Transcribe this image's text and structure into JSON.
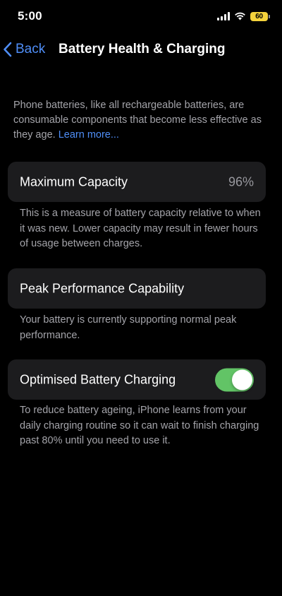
{
  "status_bar": {
    "time": "5:00",
    "battery_percent": "60",
    "battery_color": "#f5d33c",
    "signal_icon": "cellular-signal-icon",
    "wifi_icon": "wifi-icon"
  },
  "nav": {
    "back_label": "Back",
    "back_icon": "chevron-left-icon",
    "title": "Battery Health & Charging",
    "accent_color": "#4f8ef7"
  },
  "intro": {
    "text": "Phone batteries, like all rechargeable batteries, are consumable components that become less effective as they age.",
    "link": "Learn more..."
  },
  "maximum_capacity": {
    "label": "Maximum Capacity",
    "value": "96%",
    "footnote": "This is a measure of battery capacity relative to when it was new. Lower capacity may result in fewer hours of usage between charges."
  },
  "peak_performance": {
    "label": "Peak Performance Capability",
    "footnote": "Your battery is currently supporting normal peak performance."
  },
  "optimised_charging": {
    "label": "Optimised Battery Charging",
    "enabled": true,
    "toggle_color": "#62c466",
    "footnote": "To reduce battery ageing, iPhone learns from your daily charging routine so it can wait to finish charging past 80% until you need to use it."
  }
}
